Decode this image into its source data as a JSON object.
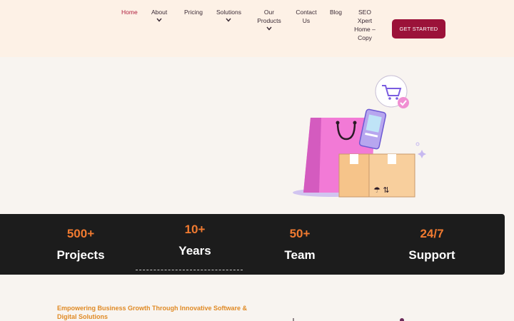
{
  "nav": {
    "items": [
      {
        "label": "Home"
      },
      {
        "label": "About"
      },
      {
        "label": "Pricing"
      },
      {
        "label": "Solutions"
      },
      {
        "label": "Our Products"
      },
      {
        "label": "Contact Us"
      },
      {
        "label": "Blog"
      },
      {
        "label": "SEO Xpert Home – Copy"
      }
    ],
    "cta_label": "GET STARTED"
  },
  "stats": [
    {
      "number": "500+",
      "label": "Projects"
    },
    {
      "number": "10+",
      "label": "Years"
    },
    {
      "number": "50+",
      "label": "Team"
    },
    {
      "number": "24/7",
      "label": "Support"
    }
  ],
  "tagline": "Empowering Business Growth Through Innovative Software & Digital Solutions",
  "colors": {
    "accent": "#9b1239",
    "active_nav": "#b0203f",
    "stat_number": "#f07a30",
    "tagline": "#e08a25"
  },
  "icons": [
    "chevron-down-icon",
    "shopping-bag-icon",
    "phone-icon",
    "cart-icon",
    "check-icon",
    "box-icon"
  ]
}
